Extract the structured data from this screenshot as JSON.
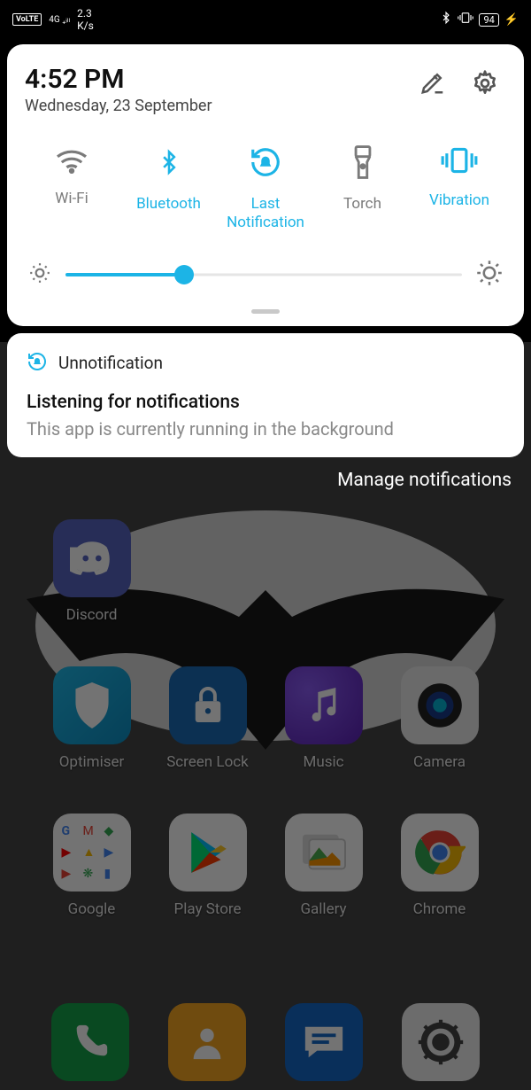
{
  "status": {
    "volte": "VoLTE",
    "network": "4G",
    "speed": "2.3",
    "speed_unit": "K/s",
    "battery": "94"
  },
  "qs": {
    "time": "4:52 PM",
    "date": "Wednesday, 23 September",
    "toggles": [
      {
        "id": "wifi",
        "label": "Wi-Fi",
        "active": false
      },
      {
        "id": "bluetooth",
        "label": "Bluetooth",
        "active": true
      },
      {
        "id": "last-notif",
        "label": "Last Notification",
        "active": true
      },
      {
        "id": "torch",
        "label": "Torch",
        "active": false
      },
      {
        "id": "vibration",
        "label": "Vibration",
        "active": true
      }
    ],
    "brightness_percent": 30
  },
  "notification": {
    "app": "Unnotification",
    "title": "Listening for notifications",
    "body": "This app is currently running in the background"
  },
  "actions": {
    "manage": "Manage notifications"
  },
  "apps": {
    "row1": [
      {
        "id": "discord",
        "label": "Discord",
        "bg": "#5865c0"
      }
    ],
    "row2": [
      {
        "id": "optimiser",
        "label": "Optimiser",
        "bg": "#17a7d9"
      },
      {
        "id": "screenlock",
        "label": "Screen Lock",
        "bg": "#1b6bb5"
      },
      {
        "id": "music",
        "label": "Music",
        "bg": "#7b4bd1"
      },
      {
        "id": "camera",
        "label": "Camera",
        "bg": "#e9e9e9"
      }
    ],
    "row3": [
      {
        "id": "google",
        "label": "Google",
        "bg": "#ffffff"
      },
      {
        "id": "playstore",
        "label": "Play Store",
        "bg": "#ffffff"
      },
      {
        "id": "gallery",
        "label": "Gallery",
        "bg": "#ffffff"
      },
      {
        "id": "chrome",
        "label": "Chrome",
        "bg": "#ffffff"
      }
    ],
    "dock": [
      {
        "id": "phone",
        "bg": "#16a34a"
      },
      {
        "id": "contacts",
        "bg": "#f5a623"
      },
      {
        "id": "messages",
        "bg": "#1668c7"
      },
      {
        "id": "settings",
        "bg": "#efefef"
      }
    ]
  }
}
